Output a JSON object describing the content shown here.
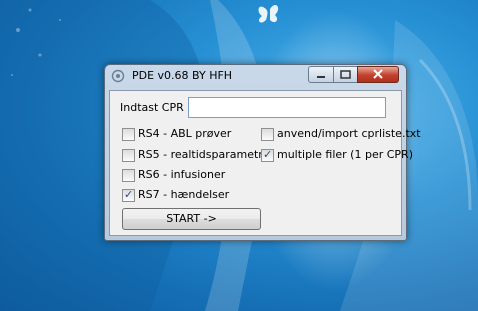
{
  "window": {
    "title": "PDE v0.68 BY HFH",
    "controls": {
      "minimize": "minimize",
      "maximize": "maximize",
      "close": "close"
    }
  },
  "form": {
    "cpr_label": "Indtast CPR",
    "cpr_value": "",
    "options_left": [
      {
        "label": "RS4 - ABL prøver",
        "checked": false
      },
      {
        "label": "RS5 - realtidsparametre",
        "checked": false
      },
      {
        "label": "RS6 - infusioner",
        "checked": false
      },
      {
        "label": "RS7 - hændelser",
        "checked": true
      }
    ],
    "options_right": [
      {
        "label": "anvend/import cprliste.txt",
        "checked": false
      },
      {
        "label": "multiple filer (1 per CPR)",
        "checked": true
      }
    ],
    "start_label": "START ->"
  },
  "colors": {
    "close_button": "#c2412c",
    "desktop": "#1f86c8",
    "client_bg": "#f0f0f0"
  }
}
